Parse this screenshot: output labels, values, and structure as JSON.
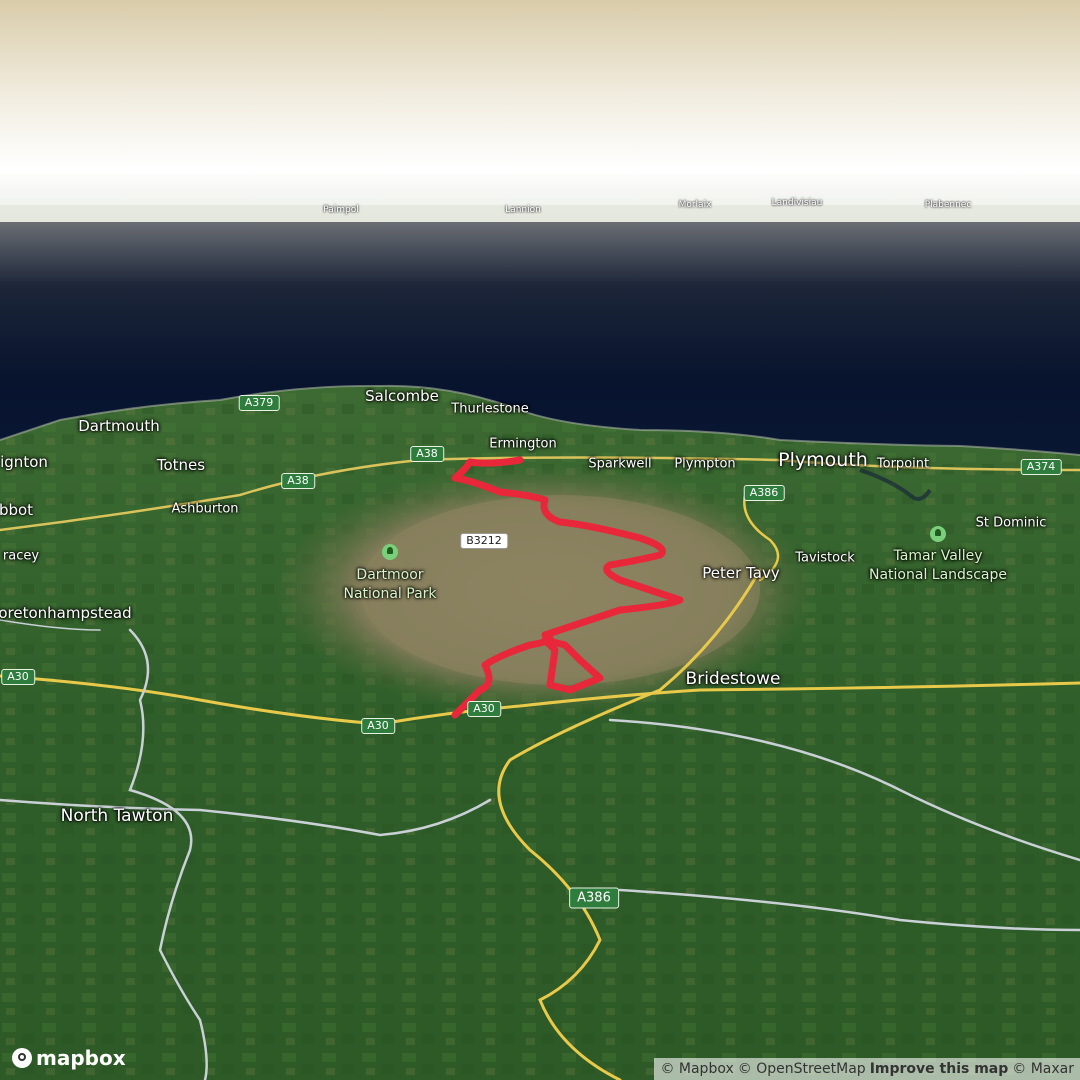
{
  "map": {
    "places": {
      "paimpol": "Paimpol",
      "lannion": "Lannion",
      "morlaix": "Morlaix",
      "landivisiau": "Landivisiau",
      "plabennec": "Plabennec",
      "salcombe": "Salcombe",
      "thurlestone": "Thurlestone",
      "dartmouth": "Dartmouth",
      "ermington": "Ermington",
      "paignton": "ignton",
      "totnes": "Totnes",
      "sparkwell": "Sparkwell",
      "plympton": "Plympton",
      "plymouth": "Plymouth",
      "torpoint": "Torpoint",
      "abbot": "bbot",
      "ashburton": "Ashburton",
      "st_dominic": "St Dominic",
      "tracey": "racey",
      "tavistock": "Tavistock",
      "peter_tavy": "Peter Tavy",
      "moretonhampstead": "oretonhampstead",
      "bridestowe": "Bridestowe",
      "north_tawton": "North Tawton"
    },
    "parks": {
      "dartmoor_line1": "Dartmoor",
      "dartmoor_line2": "National Park",
      "tamar_line1": "Tamar Valley",
      "tamar_line2": "National Landscape"
    },
    "roads": {
      "a379": "A379",
      "a38_1": "A38",
      "a38_2": "A38",
      "a386_top": "A386",
      "a374": "A374",
      "b3212": "B3212",
      "a30_left": "A30",
      "a30_mid": "A30",
      "a30_right": "A30",
      "a386_bottom": "A386"
    },
    "route_color": "#e8283a"
  },
  "brand": {
    "logo_text": "mapbox"
  },
  "attribution": {
    "mapbox": "© Mapbox",
    "osm": "© OpenStreetMap",
    "improve": "Improve this map",
    "maxar": "© Maxar"
  }
}
